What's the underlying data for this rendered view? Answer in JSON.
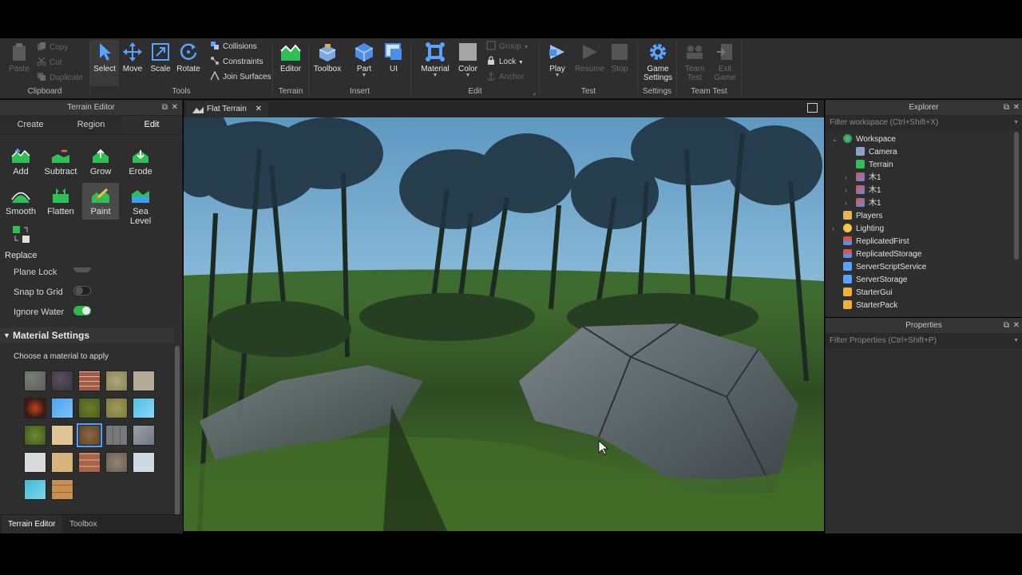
{
  "ribbon": {
    "clipboard": {
      "label": "Clipboard",
      "paste": "Paste",
      "copy": "Copy",
      "cut": "Cut",
      "duplicate": "Duplicate"
    },
    "tools": {
      "label": "Tools",
      "select": "Select",
      "move": "Move",
      "scale": "Scale",
      "rotate": "Rotate",
      "collisions": "Collisions",
      "constraints": "Constraints",
      "join_surfaces": "Join Surfaces"
    },
    "terrain": {
      "label": "Terrain",
      "editor": "Editor"
    },
    "insert": {
      "label": "Insert",
      "toolbox": "Toolbox",
      "part": "Part",
      "ui": "UI"
    },
    "edit": {
      "label": "Edit",
      "material": "Material",
      "color": "Color",
      "group": "Group",
      "lock": "Lock",
      "anchor": "Anchor"
    },
    "test": {
      "label": "Test",
      "play": "Play",
      "resume": "Resume",
      "stop": "Stop"
    },
    "settings": {
      "label": "Settings",
      "game_settings_1": "Game",
      "game_settings_2": "Settings"
    },
    "team_test": {
      "label": "Team Test",
      "team_1": "Team",
      "team_2": "Test",
      "exit_1": "Exit",
      "exit_2": "Game"
    }
  },
  "terrain_editor": {
    "title": "Terrain Editor",
    "tabs": [
      "Create",
      "Region",
      "Edit"
    ],
    "active_tab": "Edit",
    "tools": [
      "Add",
      "Subtract",
      "Grow",
      "Erode",
      "Smooth",
      "Flatten",
      "Paint",
      "Sea Level",
      "Replace"
    ],
    "active_tool": "Paint",
    "settings": {
      "plane_lock": "Plane Lock",
      "snap_to_grid": "Snap to Grid",
      "ignore_water": "Ignore Water",
      "ignore_water_on": true,
      "snap_to_grid_on": false
    },
    "material_settings": {
      "header": "Material Settings",
      "prompt": "Choose a material to apply"
    },
    "bottom_tabs": [
      "Terrain Editor",
      "Toolbox"
    ]
  },
  "viewport": {
    "tab_title": "Flat Terrain"
  },
  "explorer": {
    "title": "Explorer",
    "filter_placeholder": "Filter workspace (Ctrl+Shift+X)",
    "items": [
      "Workspace",
      "Camera",
      "Terrain",
      "木1",
      "木1",
      "木1",
      "Players",
      "Lighting",
      "ReplicatedFirst",
      "ReplicatedStorage",
      "ServerScriptService",
      "ServerStorage",
      "StarterGui",
      "StarterPack"
    ]
  },
  "properties": {
    "title": "Properties",
    "filter_placeholder": "Filter Properties (Ctrl+Shift+P)"
  },
  "colors": {
    "accent_blue": "#4aa3ff",
    "toggle_green": "#2eb84b",
    "panel_bg": "#2e2e2e",
    "terrain_green": "#32c25a"
  }
}
